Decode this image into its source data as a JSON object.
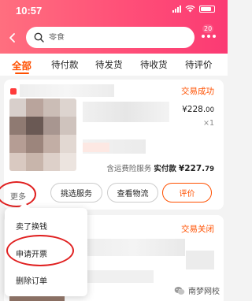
{
  "status_bar": {
    "time": "10:57"
  },
  "search": {
    "placeholder": "零食",
    "badge": "20"
  },
  "tabs": [
    "全部",
    "待付款",
    "待发货",
    "待收货",
    "待评价"
  ],
  "orders": [
    {
      "status": "交易成功",
      "price_symbol": "¥",
      "price_int": "228.",
      "price_dec": "00",
      "quantity": "×1",
      "service": "含运费险服务",
      "paid_label": "实付款",
      "paid_symbol": "¥",
      "paid_int": "227.",
      "paid_dec": "79",
      "more": "更多",
      "actions": [
        "挑选服务",
        "查看物流",
        "评价"
      ]
    },
    {
      "status": "交易关闭"
    }
  ],
  "popup_menu": [
    "卖了换钱",
    "申请开票",
    "删除订单"
  ],
  "watermark": "南梦网校",
  "colors": {
    "accent": "#ff5000",
    "header": "#ff4f78",
    "annotation": "#e02020"
  }
}
